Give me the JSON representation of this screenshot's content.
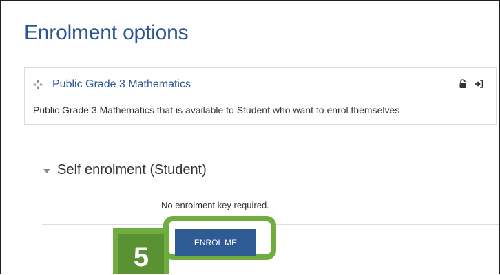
{
  "page": {
    "title": "Enrolment options"
  },
  "course": {
    "name": "Public Grade 3 Mathematics",
    "summary": "Public Grade 3 Mathematics that is available to Student who want to enrol themselves",
    "icons": [
      "course-icon",
      "lock-open-icon",
      "enrol-arrow-icon"
    ]
  },
  "self_enrolment": {
    "section_title": "Self enrolment (Student)",
    "note": "No enrolment key required.",
    "button_label": "ENROL ME"
  },
  "annotation": {
    "step_number": "5"
  },
  "colors": {
    "link": "#2b5594",
    "button": "#2f5b93",
    "highlight": "#6fae3e",
    "badge": "#5a9132"
  }
}
